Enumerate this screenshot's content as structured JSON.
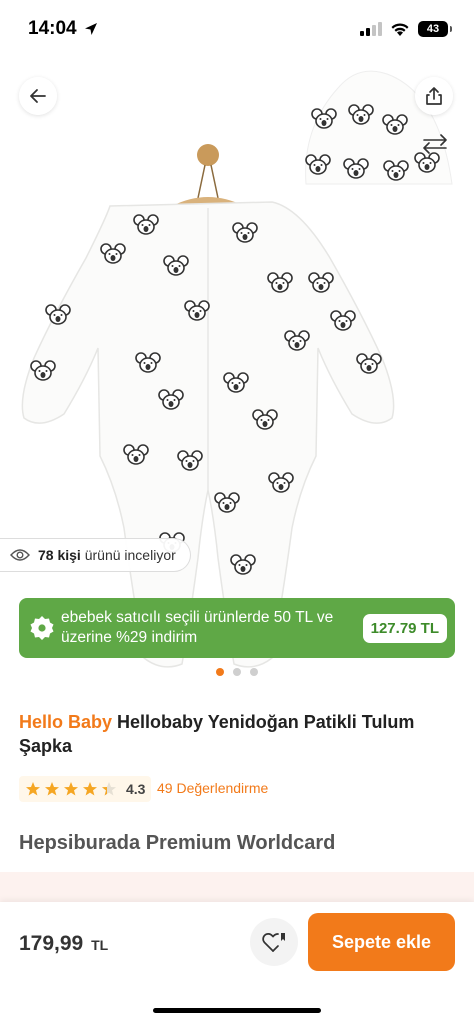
{
  "status": {
    "time": "14:04",
    "battery": "43"
  },
  "gallery": {
    "viewers_count": "78 kişi",
    "viewers_text": "ürünü inceliyor",
    "promo_text": "ebebek satıcılı seçili ürünlerde 50 TL ve üzerine %29 indirim",
    "promo_price": "127.79 TL",
    "slide_count": 3,
    "active_slide": 1
  },
  "product": {
    "brand": "Hello Baby",
    "name": "Hellobaby Yenidoğan Patikli Tulum Şapka",
    "rating": "4.3",
    "rating_stars": 4.3,
    "review_text": "49 Değerlendirme",
    "seller": "Hepsiburada Premium Worldcard"
  },
  "bottom": {
    "price": "179,99",
    "currency": "TL",
    "add_to_cart": "Sepete ekle"
  },
  "colors": {
    "accent": "#f27a1a",
    "promo_green": "#5fa846",
    "rating_star": "#f5a623"
  }
}
